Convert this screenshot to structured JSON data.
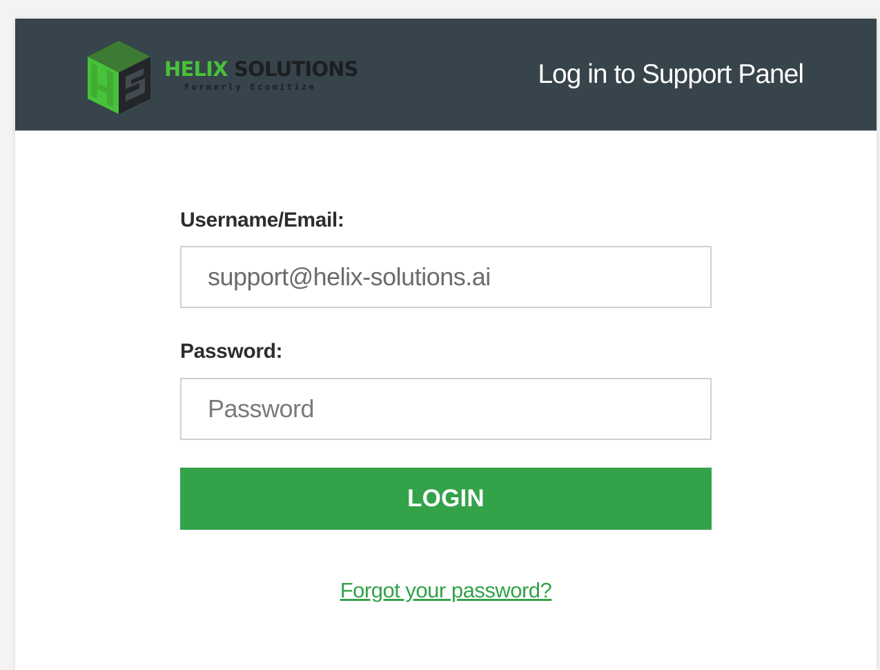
{
  "header": {
    "title": "Log in to Support Panel",
    "logo": {
      "name_part1": "HELIX",
      "name_part2": " SOLUTIONS",
      "tagline": "Formerly Ecomitize"
    }
  },
  "form": {
    "username_label": "Username/Email:",
    "username_value": "support@helix-solutions.ai",
    "password_label": "Password:",
    "password_placeholder": "Password",
    "login_label": "LOGIN",
    "forgot_label": "Forgot your password?"
  },
  "colors": {
    "header_bg": "#37444b",
    "accent_green": "#33a249",
    "logo_green": "#47c23a"
  }
}
